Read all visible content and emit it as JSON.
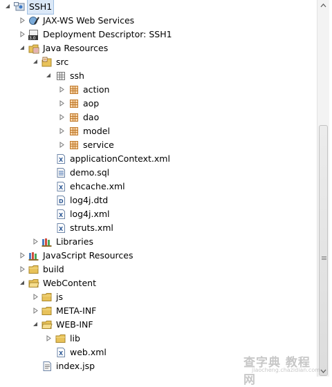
{
  "tree": {
    "items": [
      {
        "label": "SSH1",
        "icon": "project-icon",
        "twisty": "expanded",
        "selected": true
      },
      {
        "label": "JAX-WS Web Services",
        "icon": "webservices-icon",
        "twisty": "collapsed"
      },
      {
        "label": "Deployment Descriptor: SSH1",
        "icon": "deployment-descriptor-icon",
        "twisty": "collapsed"
      },
      {
        "label": "Java Resources",
        "icon": "java-resources-icon",
        "twisty": "expanded"
      },
      {
        "label": "src",
        "icon": "source-folder-icon",
        "twisty": "expanded"
      },
      {
        "label": "ssh",
        "icon": "package-icon",
        "twisty": "expanded"
      },
      {
        "label": "action",
        "icon": "package-icon",
        "twisty": "collapsed"
      },
      {
        "label": "aop",
        "icon": "package-icon",
        "twisty": "collapsed"
      },
      {
        "label": "dao",
        "icon": "package-icon",
        "twisty": "collapsed"
      },
      {
        "label": "model",
        "icon": "package-icon",
        "twisty": "collapsed"
      },
      {
        "label": "service",
        "icon": "package-icon",
        "twisty": "collapsed"
      },
      {
        "label": "applicationContext.xml",
        "icon": "xml-file-icon",
        "twisty": "none"
      },
      {
        "label": "demo.sql",
        "icon": "sql-file-icon",
        "twisty": "none"
      },
      {
        "label": "ehcache.xml",
        "icon": "xml-file-icon",
        "twisty": "none"
      },
      {
        "label": "log4j.dtd",
        "icon": "dtd-file-icon",
        "twisty": "none"
      },
      {
        "label": "log4j.xml",
        "icon": "xml-file-icon",
        "twisty": "none"
      },
      {
        "label": "struts.xml",
        "icon": "xml-file-icon",
        "twisty": "none"
      },
      {
        "label": "Libraries",
        "icon": "libraries-icon",
        "twisty": "collapsed"
      },
      {
        "label": "JavaScript Resources",
        "icon": "javascript-resources-icon",
        "twisty": "collapsed"
      },
      {
        "label": "build",
        "icon": "folder-icon",
        "twisty": "collapsed"
      },
      {
        "label": "WebContent",
        "icon": "folder-icon",
        "twisty": "expanded"
      },
      {
        "label": "js",
        "icon": "folder-icon",
        "twisty": "collapsed"
      },
      {
        "label": "META-INF",
        "icon": "folder-icon",
        "twisty": "collapsed"
      },
      {
        "label": "WEB-INF",
        "icon": "folder-icon",
        "twisty": "expanded"
      },
      {
        "label": "lib",
        "icon": "folder-icon",
        "twisty": "collapsed"
      },
      {
        "label": "web.xml",
        "icon": "xml-file-icon",
        "twisty": "none"
      },
      {
        "label": "index.jsp",
        "icon": "jsp-file-icon",
        "twisty": "none"
      }
    ]
  },
  "watermark": {
    "line1": "查字典 教程网",
    "line2": "jiaocheng.chazidian.com"
  },
  "colors": {
    "selection": "#dbe8f7",
    "folder": "#e8c25a",
    "package": "#d9893a"
  }
}
